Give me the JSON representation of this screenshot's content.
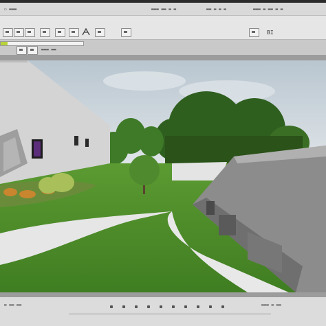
{
  "menubar": {
    "left_text": "▭ ▬▬▬",
    "center_text": "▬▬▬ ▬▬ ▬ ▬",
    "status_text": "▬▬ ▬ ▬ ▬",
    "right_text": "▬▬▬ ▬ ▬▬ ▬ ▬"
  },
  "toolbar": {
    "icons": [
      "select-icon",
      "move-icon",
      "rotate-icon",
      "scale-icon",
      "snap-icon",
      "camera-icon",
      "light-icon",
      "render-icon"
    ],
    "right_label": "BI"
  },
  "subbar": {
    "left_text": "▬▬▬ ▬▬",
    "progress": 0.08,
    "accent": "#b8d23a"
  },
  "viewport": {
    "name": "3d-scene-view"
  },
  "statusbar": {
    "left_text": "▬ ▬▬ ▬▬",
    "right_text": "▬▬▬ ▬ ▬▬"
  },
  "colors": {
    "sky": "#c7d2da",
    "grass": "#4f8a2a",
    "path": "#e8e8e8",
    "building": "#d4d4d4",
    "roof": "#8a8a8a"
  }
}
